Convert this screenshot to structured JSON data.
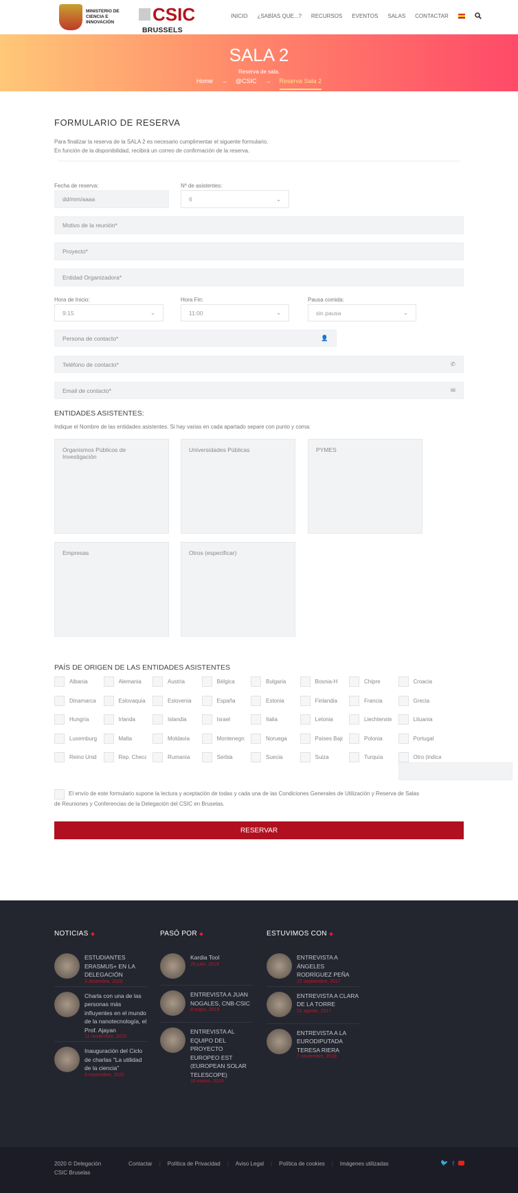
{
  "header": {
    "logo_ministry": "MINISTERIO DE CIENCIA E INNOVACIÓN",
    "logo_csic": "CSIC",
    "logo_office": "BRUSSELS OFFICE",
    "nav": [
      "INICIO",
      "¿SABÍAS QUE...?",
      "RECURSOS",
      "EVENTOS",
      "SALAS",
      "CONTACTAR"
    ]
  },
  "banner": {
    "title": "SALA 2",
    "subtitle": "Reserva de sala.",
    "breadcrumb": [
      "Home",
      "@CSIC",
      "Reserva Sala 2"
    ],
    "sep": "→"
  },
  "form": {
    "title": "FORMULARIO DE RESERVA",
    "intro1": "Para finalizar la reserva de la SALA 2 es necesario cumplimentar el siguente formulario.",
    "intro2": "En función de la disponibilidad, recibirá un correo de confirmación de la reserva.",
    "date_label": "Fecha de reserva:",
    "date_placeholder": "dd/mm/aaaa",
    "attendees_label": "Nº de asistentes:",
    "attendees_value": "6",
    "motivo": "Motivo de la reunión*",
    "proyecto": "Proyecto*",
    "entidad": "Entidad Organizadora*",
    "start_label": "Hora de Inicio:",
    "start_value": "9:15",
    "end_label": "Hora Fin:",
    "end_value": "11:00",
    "lunch_label": "Pausa comida:",
    "lunch_value": "sin pausa",
    "persona": "Persona de contacto*",
    "telefono": "Teléfono de contacto*",
    "email": "Email de contacto*",
    "entities_title": "ENTIDADES ASISTENTES:",
    "entities_help": "Indique el Nombre de las entidades asistentes. Si hay varias en cada apartado separe con punto y coma:",
    "textareas": [
      "Organismos Públicos de Investigación",
      "Universidades Públicas",
      "PYMES",
      "Empresas",
      "Otros (especificar)"
    ],
    "countries_title": "PAÍS DE ORIGEN DE LAS ENTIDADES ASISTENTES",
    "countries": [
      "Albania",
      "Alemania",
      "Austria",
      "Bélgica",
      "Bulgaria",
      "Bosnia-H",
      "Chipre",
      "Croacia",
      "Dinamarca",
      "Eslovaquia",
      "Eslovenia",
      "España",
      "Estonia",
      "Finlandia",
      "Francia",
      "Grecia",
      "Hungría",
      "Irlanda",
      "Islandia",
      "Israel",
      "Italia",
      "Letonia",
      "Liechtenstein",
      "Lituania",
      "Luxemburgo",
      "Malta",
      "Moldavia",
      "Montenegro",
      "Noruega",
      "Países Bajos",
      "Polonia",
      "Portugal",
      "Reino Unido",
      "Rep. Checa",
      "Rumanía",
      "Serbia",
      "Suecia",
      "Suiza",
      "Turquía",
      "Otro (indicar)"
    ],
    "terms1": "El envío de este formulario supone la lectura y aceptación de todas y cada una de las Condiciones Generales de Utilización y Reserva de Salas",
    "terms2": "de Reuniones y Conferencias de la Delegación del CSIC en Bruselas.",
    "submit": "RESERVAR"
  },
  "footer": {
    "columns": [
      {
        "title": "NOTICIAS",
        "items": [
          {
            "title": "ESTUDIANTES ERASMUS+ EN LA DELEGACIÓN",
            "date": "3 diciembre, 2020"
          },
          {
            "title": "Charla con una de las personas más influyentes en el mundo de la nanotecnología, el Prof. Ajayan",
            "date": "11 noviembre, 2020"
          },
          {
            "title": "Inauguración del Ciclo de charlas \"La utilidad de la ciencia\"",
            "date": "9 noviembre, 2020"
          }
        ]
      },
      {
        "title": "PASÓ POR",
        "items": [
          {
            "title": "Kardia Tool",
            "date": "25 julio, 2019"
          },
          {
            "title": "ENTREVISTA A JUAN NOGALES, CNB-CSIC",
            "date": "8 mayo, 2019"
          },
          {
            "title": "ENTREVISTA AL EQUIPO DEL PROYECTO EUROPEO EST (EUROPEAN SOLAR TELESCOPE)",
            "date": "18 marzo, 2019"
          }
        ]
      },
      {
        "title": "ESTUVIMOS CON",
        "items": [
          {
            "title": "ENTREVISTA A ÁNGELES RODRÍGUEZ PEÑA",
            "date": "22 septiembre, 2017"
          },
          {
            "title": "ENTREVISTA A CLARA DE LA TORRE",
            "date": "22 agosto, 2017"
          },
          {
            "title": "ENTREVISTA A LA EURODIPUTADA TERESA RIERA",
            "date": "7 noviembre, 2018"
          }
        ]
      }
    ],
    "copyright1": "2020 © Delegación",
    "copyright2": "CSIC Bruselas",
    "links": [
      "Contactar",
      "Política de Privacidad",
      "Aviso Legal",
      "Política de cookies",
      "Imágenes utilizadas"
    ],
    "colors": {
      "accent": "#b01020",
      "footer_bg": "#23252f"
    }
  }
}
